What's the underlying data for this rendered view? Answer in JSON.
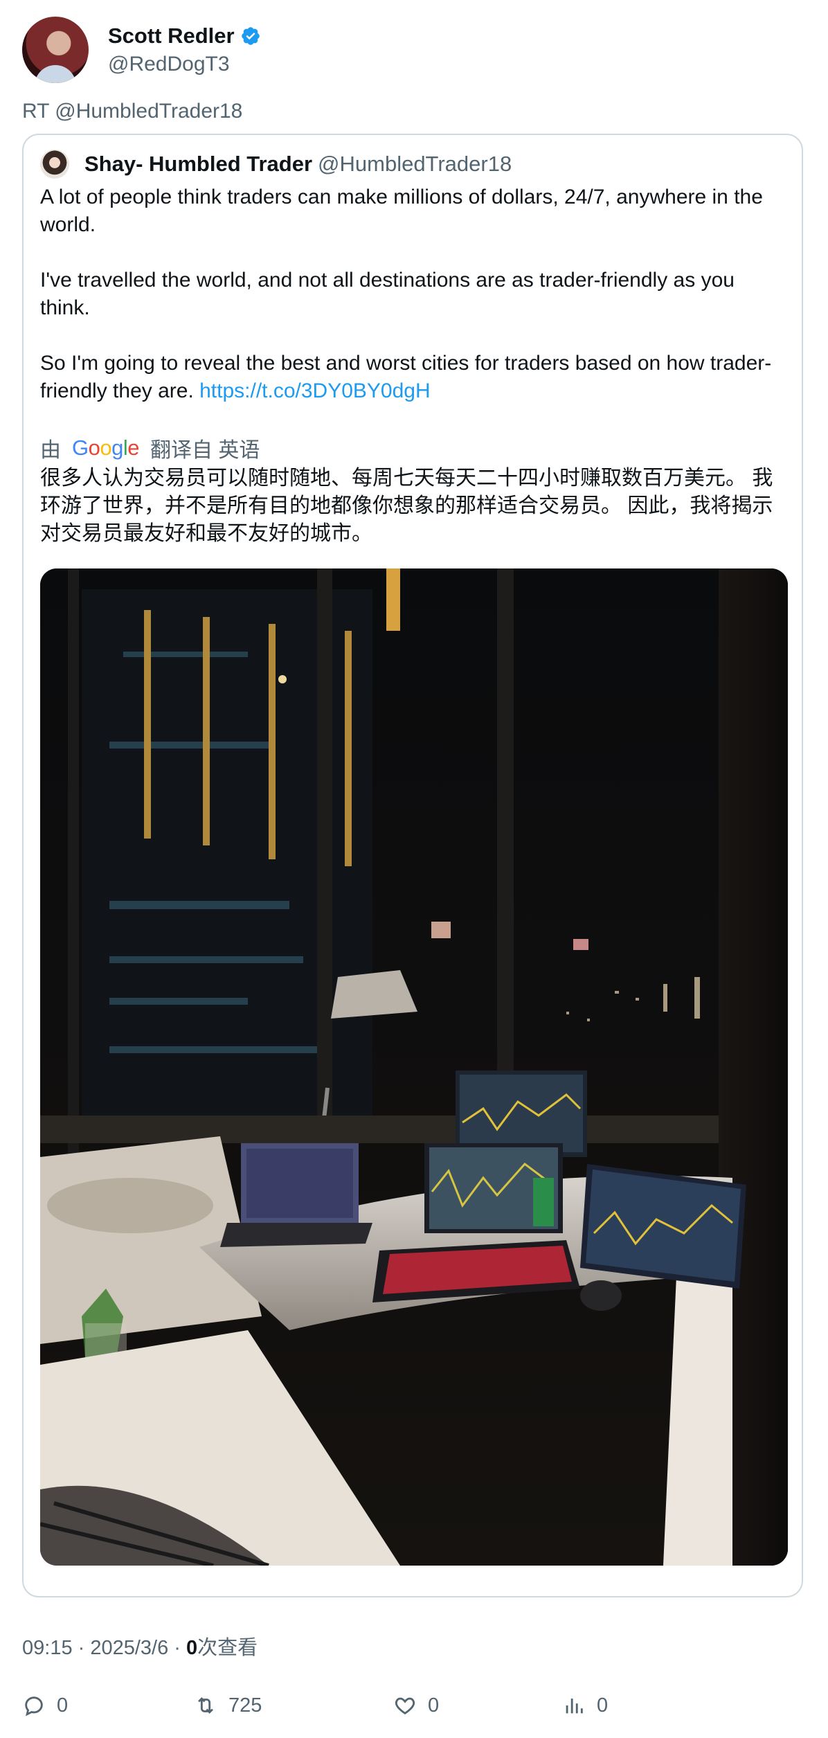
{
  "author": {
    "display_name": "Scott Redler",
    "handle": "@RedDogT3",
    "verified_icon": "verified-badge-icon",
    "verified_color": "#1d9bf0"
  },
  "retweet_label": "RT @HumbledTrader18",
  "quoted": {
    "display_name": "Shay- Humbled Trader",
    "handle": "@HumbledTrader18",
    "text": "A lot of people think traders can make millions of dollars, 24/7, anywhere in the world.\n\nI've travelled the world, and not all destinations are as trader-friendly as you think.\n\nSo I'm going to reveal the best and worst cities for traders based on how trader-friendly they are. ",
    "link": "https://t.co/3DY0BY0dgH",
    "translation": {
      "prefix": "由",
      "provider": "Google",
      "suffix": "翻译自 英语",
      "text": "很多人认为交易员可以随时随地、每周七天每天二十四小时赚取数百万美元。 我环游了世界，并不是所有目的地都像你想象的那样适合交易员。 因此，我将揭示对交易员最友好和最不友好的城市。"
    }
  },
  "meta": {
    "time": "09:15 · 2025/3/6 · ",
    "views": "0",
    "views_label": "次查看"
  },
  "actions": {
    "replies": "0",
    "retweets": "725",
    "likes": "0",
    "views": "0"
  },
  "colors": {
    "text": "#0f1419",
    "muted": "#536471",
    "link": "#1d9bf0",
    "border": "#cfd9de"
  }
}
